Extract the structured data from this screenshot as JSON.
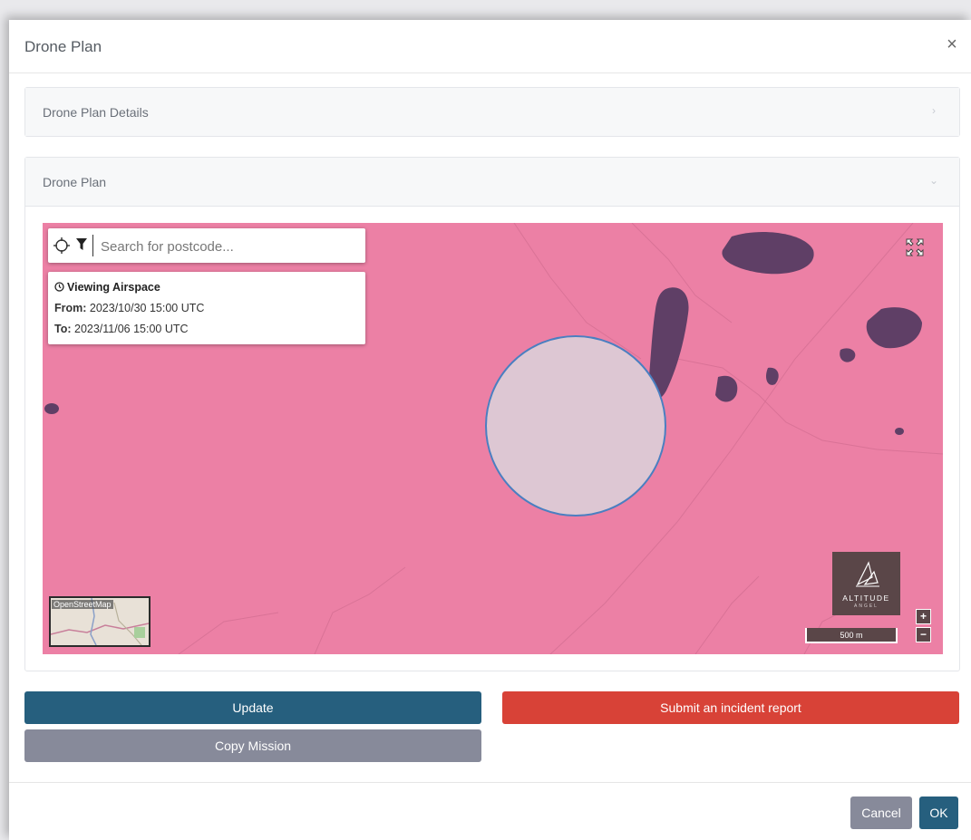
{
  "modal": {
    "title": "Drone Plan",
    "close_label": "×"
  },
  "panels": {
    "details": {
      "title": "Drone Plan Details",
      "chevron": "›"
    },
    "plan": {
      "title": "Drone Plan",
      "chevron": "⌄"
    }
  },
  "map": {
    "search_placeholder": "Search for postcode...",
    "airspace": {
      "title": "Viewing Airspace",
      "from_label": "From:",
      "from_value": "2023/10/30 15:00 UTC",
      "to_label": "To:",
      "to_value": "2023/11/06 15:00 UTC"
    },
    "attribution": "OpenStreetMap",
    "logo_name": "ALTITUDE",
    "logo_tagline": "ANGEL",
    "scale": "500 m",
    "zoom_in": "+",
    "zoom_out": "−",
    "colors": {
      "restricted_area": "#ec80a5",
      "flight_area": "#ddc7d3",
      "flight_border": "#4a7fc1"
    }
  },
  "actions": {
    "update": "Update",
    "copy": "Copy Mission",
    "incident": "Submit an incident report"
  },
  "footer": {
    "cancel": "Cancel",
    "ok": "OK"
  }
}
